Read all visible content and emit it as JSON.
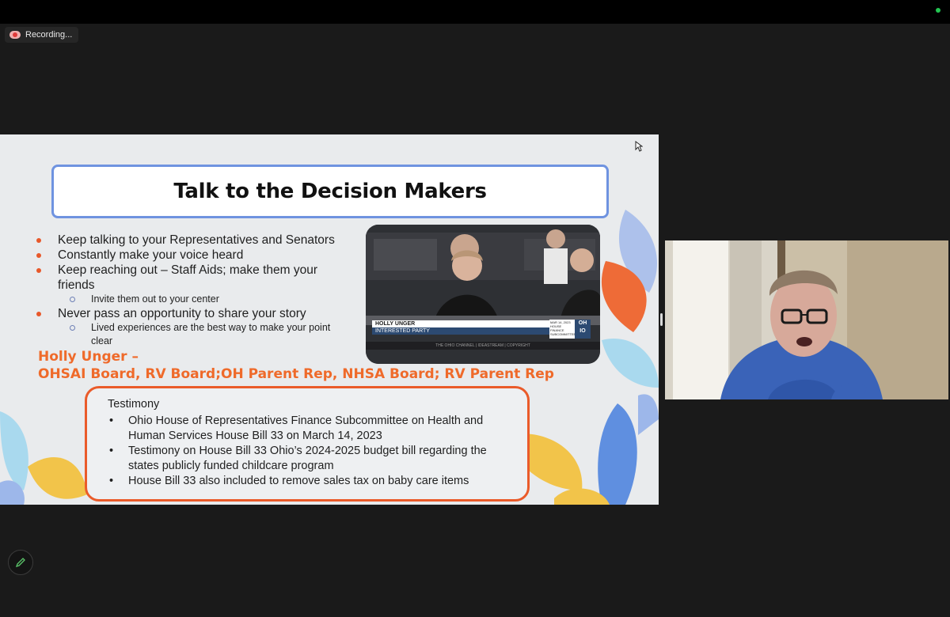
{
  "recording": {
    "label": "Recording..."
  },
  "slide": {
    "title": "Talk to the Decision Makers",
    "bullets": [
      {
        "level": 1,
        "text": "Keep talking to your Representatives and Senators"
      },
      {
        "level": 1,
        "text": "Constantly make your voice heard"
      },
      {
        "level": 1,
        "text": "Keep reaching out – Staff Aids; make them your friends"
      },
      {
        "level": 2,
        "text": "Invite them out to your center"
      },
      {
        "level": 1,
        "text": "Never pass an opportunity to share your story"
      },
      {
        "level": 2,
        "text": "Lived experiences are the best way to make your point clear"
      }
    ],
    "photo": {
      "name_caption": "HOLLY UNGER",
      "role_caption": "INTERESTED PARTY",
      "date_caption": "MAR 14, 2023",
      "committee_caption": "HOUSE FINANCE SUBCOMMITTEE",
      "logo_top": "OH",
      "logo_bottom": "IO",
      "ticker": "THE OHIO CHANNEL  |  IDEASTREAM  |  COPYRIGHT"
    },
    "presenter_line1": "Holly Unger –",
    "presenter_line2": "OHSAI Board, RV Board;OH Parent Rep, NHSA Board; RV Parent Rep",
    "testimony": {
      "heading": "Testimony",
      "items": [
        "Ohio House of Representatives Finance Subcommittee on Health and Human Services House Bill 33 on March 14, 2023",
        "Testimony on House Bill 33 Ohio’s 2024-2025 budget bill regarding the states publicly funded childcare program",
        "House Bill 33 also included to remove sales tax on baby care items"
      ]
    }
  },
  "colors": {
    "accent_orange": "#ea5b2a",
    "title_border_blue": "#6f93e0",
    "status_green": "#23c552"
  },
  "icons": {
    "recording": "recording-icon",
    "edit": "pencil-icon",
    "cursor": "mouse-pointer-icon"
  }
}
